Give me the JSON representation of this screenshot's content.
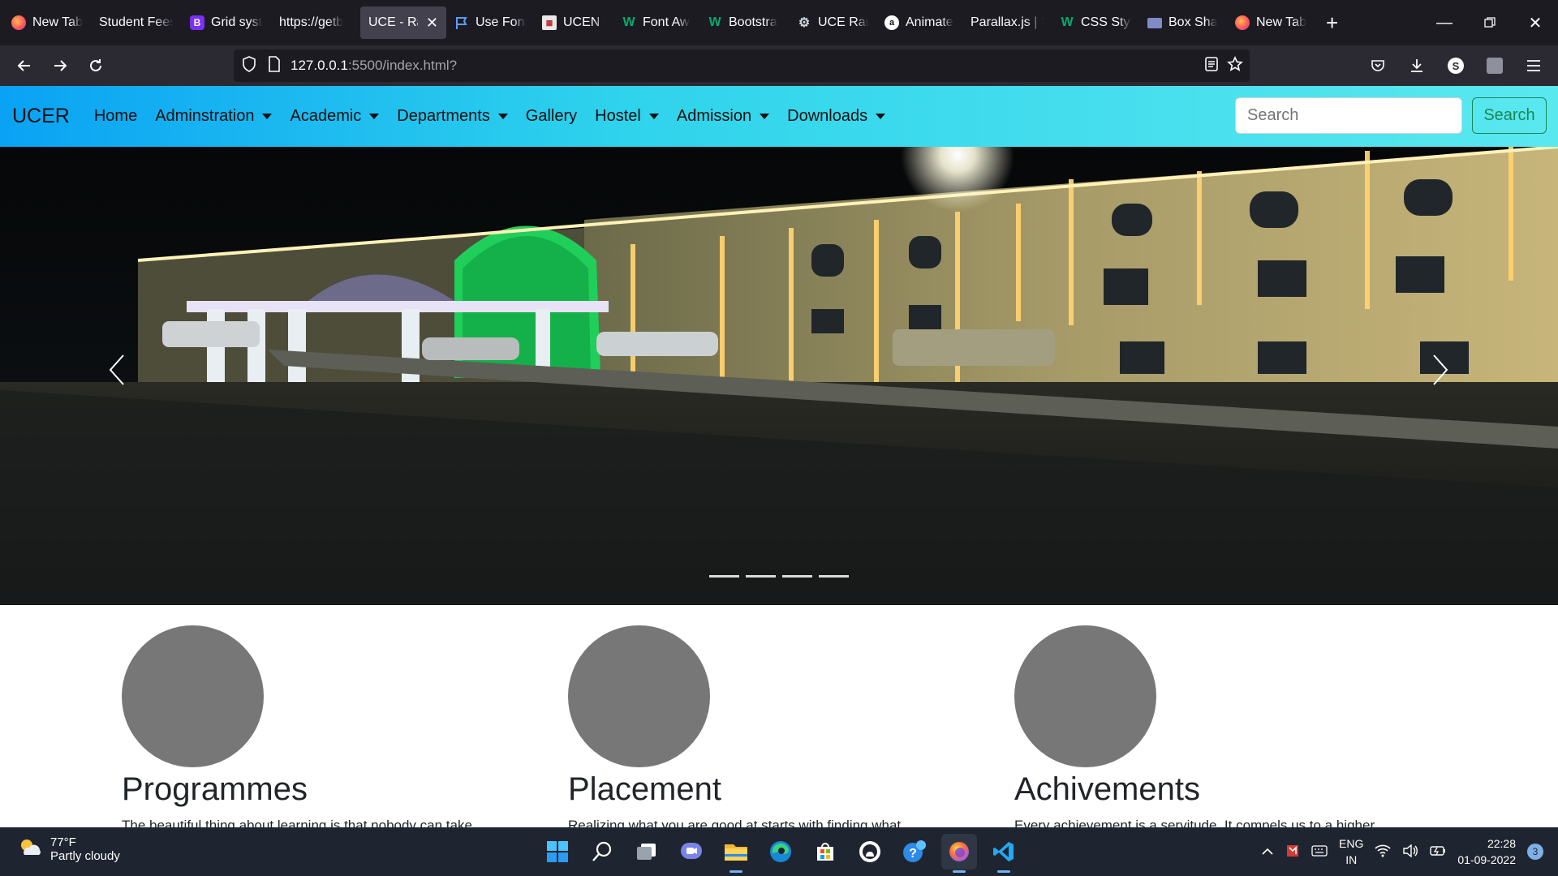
{
  "browser": {
    "tabs": [
      {
        "label": "New Tab",
        "icon": "firefox-icon"
      },
      {
        "label": "Student Fees",
        "icon": "none"
      },
      {
        "label": "Grid syst",
        "icon": "bootstrap-icon"
      },
      {
        "label": "https://getb",
        "icon": "none"
      },
      {
        "label": "UCE - Ran",
        "icon": "none",
        "active": true
      },
      {
        "label": "Use Font",
        "icon": "flag-icon"
      },
      {
        "label": "UCEN - ",
        "icon": "ucen-icon"
      },
      {
        "label": "Font Aw",
        "icon": "w3schools-icon"
      },
      {
        "label": "Bootstra",
        "icon": "w3schools-icon"
      },
      {
        "label": "UCE Ran",
        "icon": "gear-icon"
      },
      {
        "label": "Animate",
        "icon": "animate-icon"
      },
      {
        "label": "Parallax.js | S",
        "icon": "none"
      },
      {
        "label": "CSS Styl",
        "icon": "w3schools-icon"
      },
      {
        "label": "Box Sha",
        "icon": "box-icon"
      },
      {
        "label": "New Tab",
        "icon": "firefox-icon"
      }
    ],
    "url_host": "127.0.0.1",
    "url_rest": ":5500/index.html?"
  },
  "site": {
    "brand": "UCER",
    "menu": [
      {
        "label": "Home",
        "dropdown": false
      },
      {
        "label": "Adminstration",
        "dropdown": true
      },
      {
        "label": "Academic",
        "dropdown": true
      },
      {
        "label": "Departments",
        "dropdown": true
      },
      {
        "label": "Gallery",
        "dropdown": false
      },
      {
        "label": "Hostel",
        "dropdown": true
      },
      {
        "label": "Admission",
        "dropdown": true
      },
      {
        "label": "Downloads",
        "dropdown": true
      }
    ],
    "search_placeholder": "Search",
    "search_button": "Search",
    "carousel_slides": 4,
    "features": [
      {
        "title": "Programmes",
        "text": "The beautiful thing about learning is that nobody can take"
      },
      {
        "title": "Placement",
        "text": "Realizing what you are good at starts with finding what"
      },
      {
        "title": "Achivements",
        "text": "Every achievement is a servitude. It compels us to a higher"
      }
    ]
  },
  "taskbar": {
    "temperature": "77°F",
    "condition": "Partly cloudy",
    "lang1": "ENG",
    "lang2": "IN",
    "time": "22:28",
    "date": "01-09-2022",
    "notifications": "3"
  },
  "colors": {
    "nav_gradient_start": "#0aa2f4",
    "nav_gradient_end": "#5ae8ef",
    "search_button": "#198754",
    "placeholder_circle": "#777777"
  }
}
